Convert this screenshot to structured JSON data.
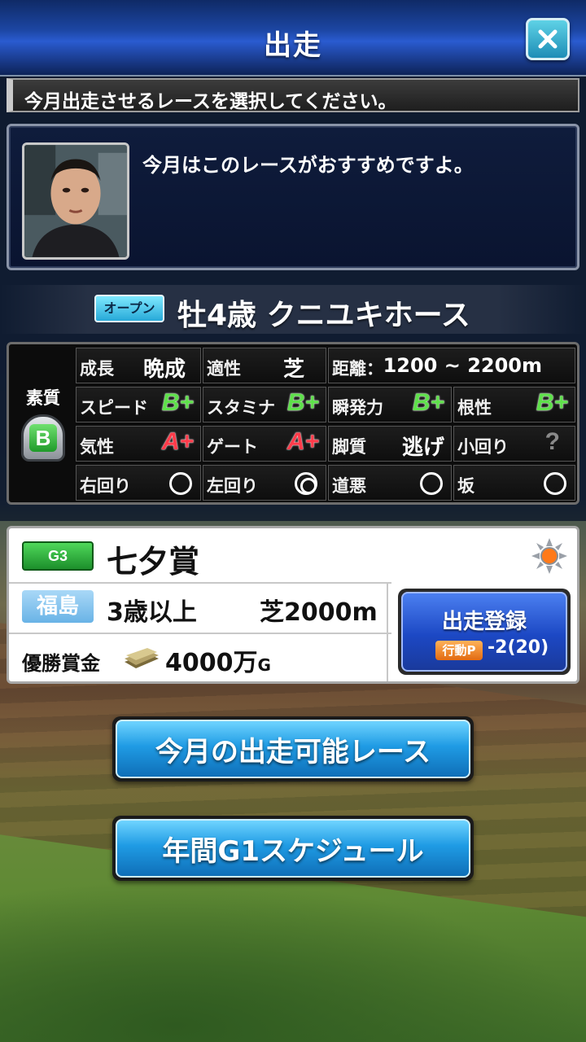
{
  "header": {
    "title": "出走",
    "close_icon": "close-icon"
  },
  "instruction": "今月出走させるレースを選択してください。",
  "advisor": {
    "message": "今月はこのレースがおすすめですよ。",
    "portrait": "trainer-portrait"
  },
  "horse": {
    "class_badge": "オープン",
    "name": "牡4歳 クニユキホース"
  },
  "aptitude": {
    "label": "素質",
    "grade": "B"
  },
  "stats": [
    {
      "label": "成長",
      "value": "晩成"
    },
    {
      "label": "適性",
      "value": "芝"
    },
    {
      "label": "距離：",
      "value": "1200 ~ 2200m"
    },
    {
      "label": "スピード",
      "value": "B+"
    },
    {
      "label": "スタミナ",
      "value": "B+"
    },
    {
      "label": "瞬発力",
      "value": "B+"
    },
    {
      "label": "根性",
      "value": "B+"
    },
    {
      "label": "気性",
      "value": "A+"
    },
    {
      "label": "ゲート",
      "value": "A+"
    },
    {
      "label": "脚質",
      "value": "逃げ"
    },
    {
      "label": "小回り",
      "value": "?"
    },
    {
      "label": "右回り",
      "value": "○"
    },
    {
      "label": "左回り",
      "value": "◎"
    },
    {
      "label": "道悪",
      "value": "○"
    },
    {
      "label": "坂",
      "value": "○"
    }
  ],
  "race": {
    "grade": "G3",
    "name": "七夕賞",
    "weather_icon": "sun-icon",
    "track": "福島",
    "condition": "3歳以上",
    "surface": "芝2000m",
    "prize_label": "優勝賞金",
    "prize_value": "4000万",
    "prize_unit": "G",
    "money_icon": "money-icon"
  },
  "entry_button": {
    "label": "出走登録",
    "ap_tag": "行動P",
    "ap_cost": "-2(20)"
  },
  "buttons": {
    "available_races": "今月の出走可能レース",
    "g1_schedule": "年間G1スケジュール"
  },
  "colors": {
    "header": "#1c46a3",
    "grade_b": "#5ee04a",
    "grade_a": "#ff3b4a",
    "g3_badge": "#1c8f2b",
    "entry": "#1c48c4",
    "big_button": "#1f9be4"
  }
}
